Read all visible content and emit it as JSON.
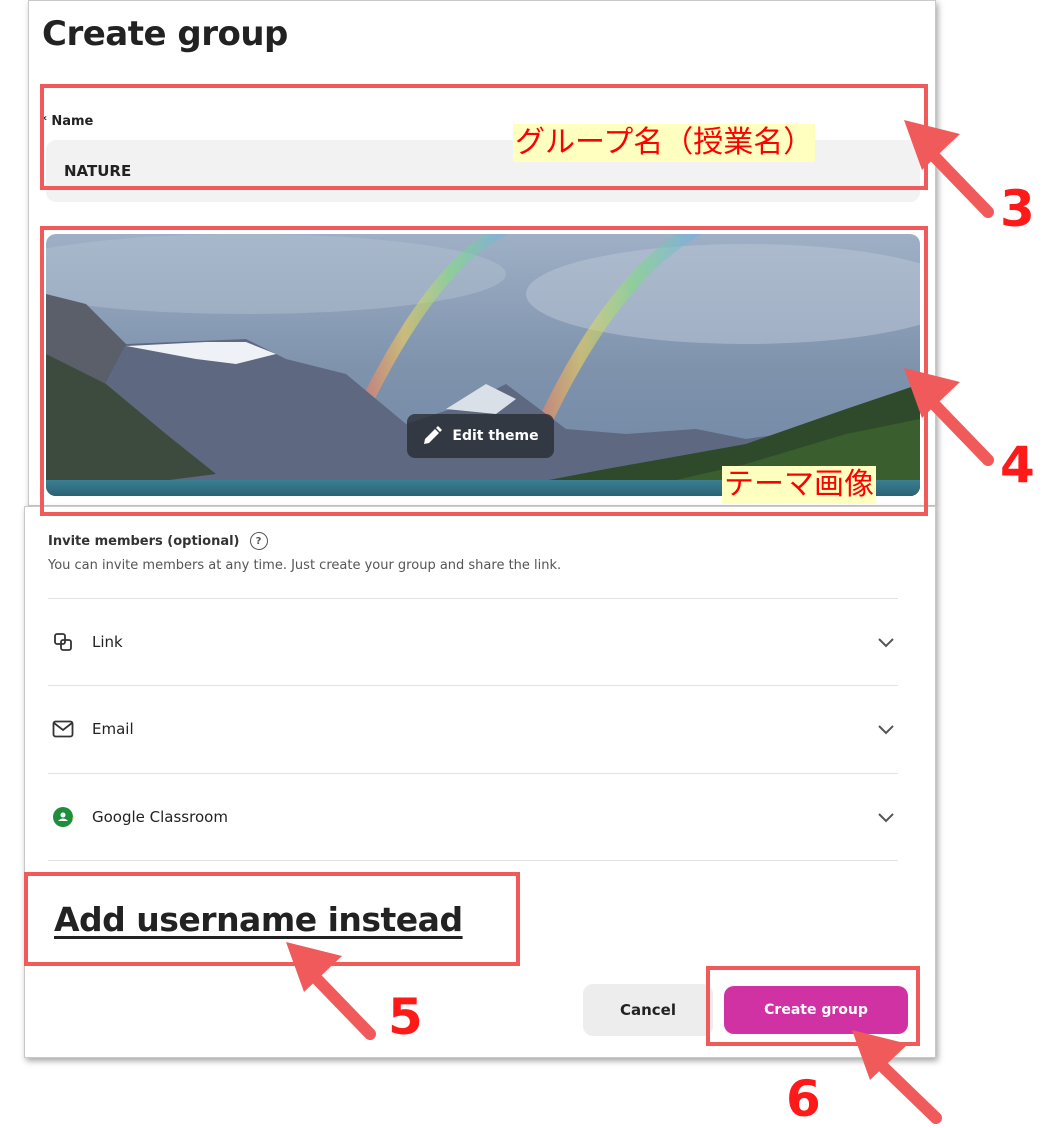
{
  "dialog": {
    "title": "Create group",
    "name_label": "* Name",
    "name_value": "NATURE",
    "edit_theme_label": "Edit theme",
    "invite_title": "Invite members (optional)",
    "invite_help": "?",
    "invite_desc": "You can invite members at any time. Just create your group and share the link.",
    "invite_options": [
      {
        "label": "Link",
        "icon": "link-icon"
      },
      {
        "label": "Email",
        "icon": "envelope-icon"
      },
      {
        "label": "Google Classroom",
        "icon": "google-classroom-icon"
      }
    ],
    "add_username_label": "Add username instead",
    "cancel_label": "Cancel",
    "create_label": "Create group"
  },
  "annotations": {
    "group_name_note": "グループ名（授業名）",
    "theme_image_note": "テーマ画像",
    "step_numbers": [
      "3",
      "4",
      "5",
      "6"
    ]
  },
  "colors": {
    "accent": "#d032a4",
    "annotation_red": "#ff1a1a",
    "annotation_box": "#f15a5a",
    "label_highlight": "#ffffc0",
    "google_classroom_green": "#1e8e3e"
  }
}
